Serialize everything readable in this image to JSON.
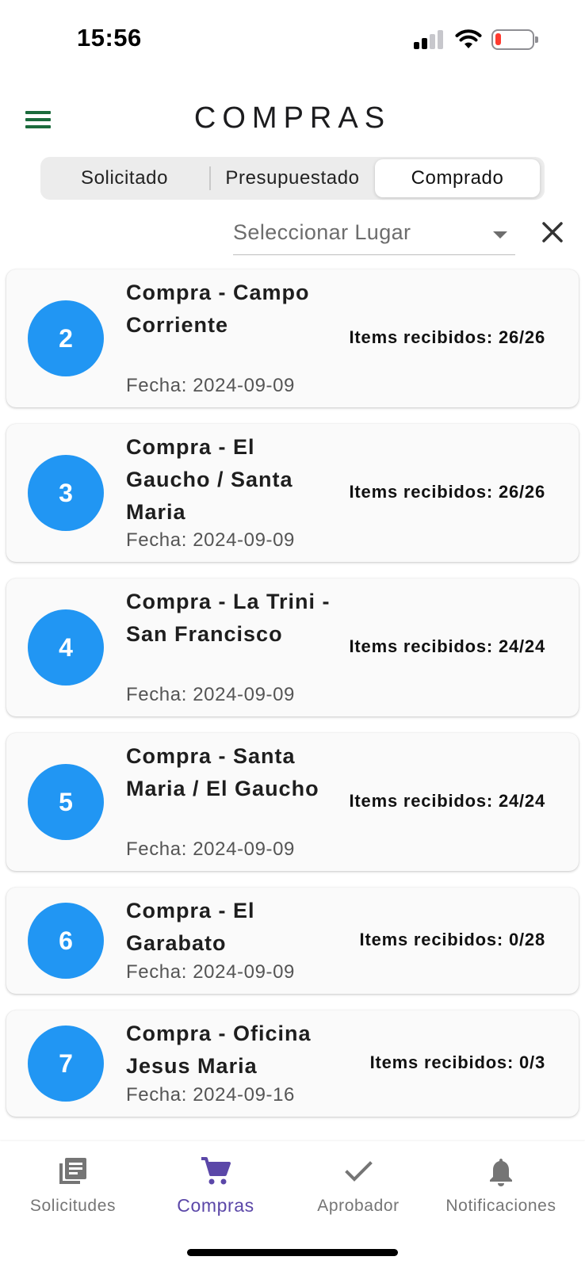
{
  "status_bar": {
    "time": "15:56"
  },
  "header": {
    "title": "COMPRAS"
  },
  "tabs": [
    "Solicitado",
    "Presupuestado",
    "Comprado"
  ],
  "selected_tab": "Comprado",
  "filter": {
    "place_placeholder": "Seleccionar Lugar"
  },
  "purchases": [
    {
      "number": "2",
      "title": "Compra  - Campo Corriente",
      "date": "Fecha: 2024-09-09",
      "items": "Items recibidos: 26/26"
    },
    {
      "number": "3",
      "title": "Compra  - El Gaucho / Santa Maria",
      "date": "Fecha: 2024-09-09",
      "items": "Items recibidos: 26/26"
    },
    {
      "number": "4",
      "title": "Compra  - La Trini - San Francisco",
      "date": "Fecha: 2024-09-09",
      "items": "Items recibidos: 24/24"
    },
    {
      "number": "5",
      "title": "Compra  - Santa Maria / El Gaucho",
      "date": "Fecha: 2024-09-09",
      "items": "Items recibidos: 24/24"
    },
    {
      "number": "6",
      "title": "Compra  - El Garabato",
      "date": "Fecha: 2024-09-09",
      "items": "Items recibidos: 0/28"
    },
    {
      "number": "7",
      "title": "Compra  - Oficina Jesus Maria",
      "date": "Fecha: 2024-09-16",
      "items": "Items recibidos: 0/3"
    }
  ],
  "bottom_nav": {
    "items": [
      {
        "label": "Solicitudes",
        "icon": "library-books-icon"
      },
      {
        "label": "Compras",
        "icon": "shopping-cart-icon"
      },
      {
        "label": "Aprobador",
        "icon": "check-icon"
      },
      {
        "label": "Notificaciones",
        "icon": "bell-icon"
      }
    ],
    "active": "Compras"
  },
  "colors": {
    "avatar": "#2196f3",
    "menu_icon": "#1b6b3c",
    "nav_active": "#5b47a8",
    "nav_inactive": "#757575",
    "battery_low": "#ff3b30"
  }
}
